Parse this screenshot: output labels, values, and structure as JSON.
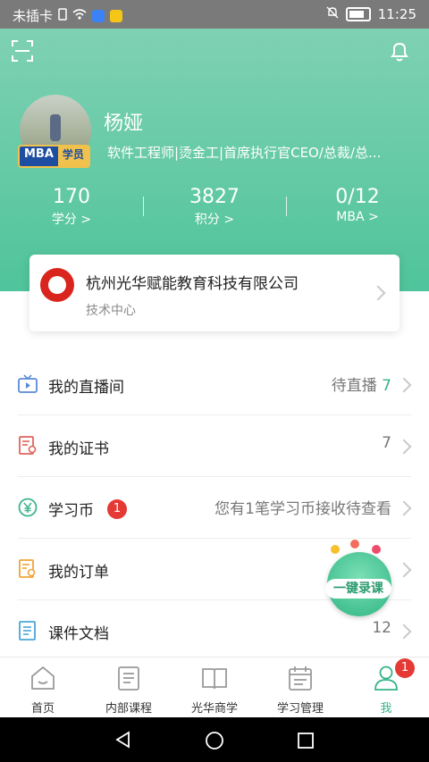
{
  "status_bar": {
    "carrier": "未插卡",
    "time": "11:25"
  },
  "header": {
    "scan_icon": "scan-icon",
    "bell_icon": "bell-icon"
  },
  "profile": {
    "name": "杨娅",
    "badge_left": "MBA",
    "badge_right": "学员",
    "bio": "软件工程师|烫金工|首席执行官CEO/总裁/总..."
  },
  "stats": [
    {
      "value": "170",
      "label": "学分 >"
    },
    {
      "value": "3827",
      "label": "积分 >"
    },
    {
      "value": "0/12",
      "label": "MBA >"
    }
  ],
  "company": {
    "name": "杭州光华赋能教育科技有限公司",
    "dept": "技术中心"
  },
  "menu": [
    {
      "label": "我的直播间",
      "value_prefix": "待直播",
      "value": "7",
      "icon": "tv-icon"
    },
    {
      "label": "我的证书",
      "value": "7",
      "icon": "certificate-icon"
    },
    {
      "label": "学习币",
      "badge": "1",
      "value": "您有1笔学习币接收待查看",
      "icon": "coin-icon"
    },
    {
      "label": "我的订单",
      "value": "",
      "icon": "order-icon"
    },
    {
      "label": "课件文档",
      "value": "12",
      "icon": "document-icon"
    }
  ],
  "floating": {
    "label": "一键录课"
  },
  "tabs": [
    {
      "label": "首页",
      "icon": "home-icon"
    },
    {
      "label": "内部课程",
      "icon": "course-icon"
    },
    {
      "label": "光华商学",
      "icon": "book-icon"
    },
    {
      "label": "学习管理",
      "icon": "calendar-icon"
    },
    {
      "label": "我",
      "icon": "user-icon",
      "badge": "1"
    }
  ],
  "colors": {
    "accent": "#34b38a",
    "header_top": "#7fd1b3",
    "header_bottom": "#4fc49b",
    "alert": "#e64545"
  }
}
